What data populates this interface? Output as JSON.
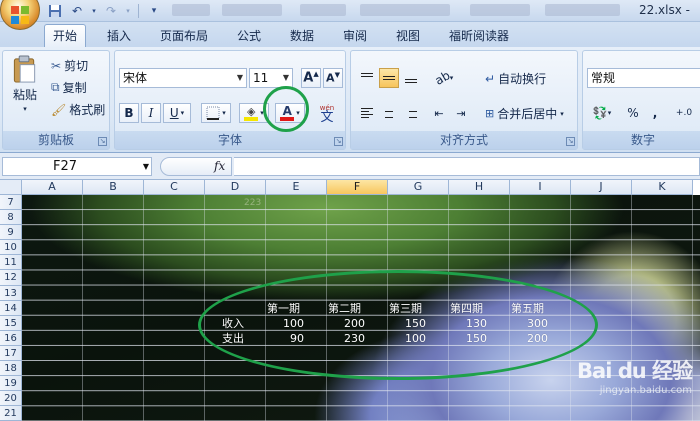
{
  "window": {
    "filename": "22.xlsx -"
  },
  "quick_access": {
    "icons": [
      "save-icon",
      "undo-icon",
      "redo-icon",
      "customize-icon"
    ]
  },
  "tabs": [
    {
      "label": "开始",
      "active": true
    },
    {
      "label": "插入"
    },
    {
      "label": "页面布局"
    },
    {
      "label": "公式"
    },
    {
      "label": "数据"
    },
    {
      "label": "审阅"
    },
    {
      "label": "视图"
    },
    {
      "label": "福昕阅读器"
    }
  ],
  "clipboard": {
    "paste": "粘贴",
    "cut": "剪切",
    "copy": "复制",
    "format_painter": "格式刷",
    "label": "剪贴板"
  },
  "font": {
    "name": "宋体",
    "size": "11",
    "bold": "B",
    "italic": "I",
    "underline": "U",
    "color_letter": "A",
    "phonetic_top": "wén",
    "phonetic_char": "文",
    "label": "字体",
    "highlight_color": "#f5e600",
    "font_color": "#e01818"
  },
  "alignment": {
    "wrap_text": "自动换行",
    "merge_center": "合并后居中",
    "label": "对齐方式"
  },
  "number": {
    "format": "常规",
    "percent": "%",
    "comma": ",",
    "decimal": "+.0",
    "label": "数字"
  },
  "formula_bar": {
    "name_box": "F27",
    "fx": "fx",
    "value": ""
  },
  "columns": [
    "A",
    "B",
    "C",
    "D",
    "E",
    "F",
    "G",
    "H",
    "I",
    "J",
    "K"
  ],
  "selected_column": "F",
  "rows": [
    "7",
    "8",
    "9",
    "10",
    "11",
    "12",
    "13",
    "14",
    "15",
    "16",
    "17",
    "18",
    "19",
    "20",
    "21"
  ],
  "table": {
    "headers": [
      "第一期",
      "第二期",
      "第三期",
      "第四期",
      "第五期"
    ],
    "rows": [
      {
        "label": "收入",
        "values": [
          "100",
          "200",
          "150",
          "130",
          "300"
        ]
      },
      {
        "label": "支出",
        "values": [
          "90",
          "230",
          "100",
          "150",
          "200"
        ]
      }
    ]
  },
  "faint_text": "223",
  "annotation_color": "#1fa14a",
  "watermark": {
    "main": "Bai du 经验",
    "sub": "jingyan.baidu.com"
  }
}
